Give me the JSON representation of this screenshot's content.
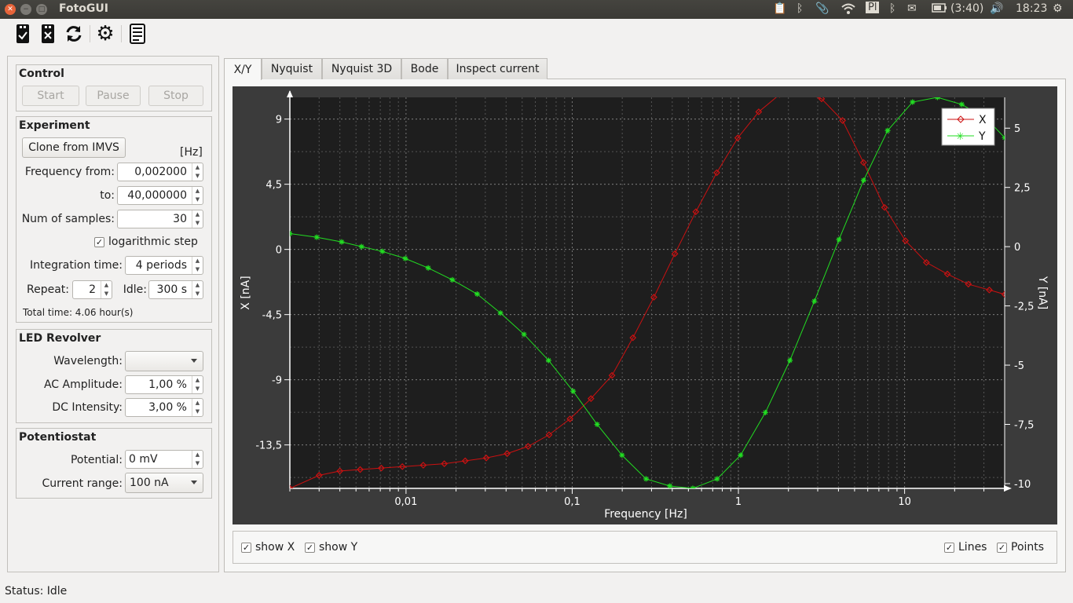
{
  "window": {
    "title": "FotoGUI"
  },
  "tray": {
    "battery": "(3:40)",
    "clock": "18:23",
    "keyboard": "Pl"
  },
  "control": {
    "title": "Control",
    "start": "Start",
    "pause": "Pause",
    "stop": "Stop"
  },
  "experiment": {
    "title": "Experiment",
    "clone_button": "Clone from IMVS",
    "unit": "[Hz]",
    "freq_from_label": "Frequency from:",
    "freq_from": "0,002000",
    "freq_to_label": "to:",
    "freq_to": "40,000000",
    "samples_label": "Num of samples:",
    "samples": "30",
    "log_label": "logarithmic step",
    "integration_label": "Integration time:",
    "integration": "4 periods",
    "repeat_label": "Repeat:",
    "repeat": "2",
    "idle_label": "Idle:",
    "idle": "300 s",
    "total_time": "Total time: 4.06 hour(s)"
  },
  "led": {
    "title": "LED Revolver",
    "wavelength_label": "Wavelength:",
    "wavelength": "",
    "ac_label": "AC Amplitude:",
    "ac": "1,00 %",
    "dc_label": "DC Intensity:",
    "dc": "3,00 %"
  },
  "potentiostat": {
    "title": "Potentiostat",
    "potential_label": "Potential:",
    "potential": "0 mV",
    "range_label": "Current range:",
    "range": "100 nA"
  },
  "tabs": [
    "X/Y",
    "Nyquist",
    "Nyquist 3D",
    "Bode",
    "Inspect current"
  ],
  "options": {
    "show_x": "show X",
    "show_y": "show Y",
    "lines": "Lines",
    "points": "Points"
  },
  "status": "Status: Idle",
  "colors": {
    "x_series": "#cc1111",
    "y_series": "#22dd22",
    "plot_bg": "#1e1e1e"
  },
  "chart_data": {
    "type": "line",
    "xlabel": "Frequency [Hz]",
    "ylabel": "X [nA]",
    "y2label": "Y [nA]",
    "xscale": "log",
    "xlim": [
      0.002,
      40
    ],
    "ylim": [
      -16.5,
      10.5
    ],
    "y2lim": [
      -10.2,
      6.3
    ],
    "x_ticks": [
      0.01,
      0.1,
      1,
      10
    ],
    "x_tick_labels": [
      "0,01",
      "0,1",
      "1",
      "10"
    ],
    "y_ticks": [
      9,
      4.5,
      0,
      -4.5,
      -9,
      -13.5
    ],
    "y_tick_labels": [
      "9",
      "4,5",
      "0",
      "-4,5",
      "-9",
      "-13,5"
    ],
    "y2_ticks": [
      5,
      2.5,
      0,
      -2.5,
      -5,
      -7.5,
      -10
    ],
    "y2_tick_labels": [
      "5",
      "2,5",
      "0",
      "-2,5",
      "-5",
      "-7,5",
      "-10"
    ],
    "grid": true,
    "legend": "top-right",
    "series": [
      {
        "name": "X",
        "axis": "left",
        "color": "#cc1111",
        "marker": "diamond",
        "x": [
          0.002,
          0.003,
          0.004,
          0.0053,
          0.0071,
          0.0095,
          0.0127,
          0.017,
          0.0227,
          0.0304,
          0.0406,
          0.0543,
          0.0726,
          0.097,
          0.1297,
          0.1735,
          0.2319,
          0.3101,
          0.4146,
          0.5543,
          0.7411,
          0.991,
          1.325,
          1.771,
          2.368,
          3.167,
          4.234,
          5.66,
          7.57,
          10.12,
          13.53,
          18.09,
          24.19,
          32.34,
          40
        ],
        "y": [
          -16.5,
          -15.6,
          -15.3,
          -15.2,
          -15.1,
          -15.0,
          -14.9,
          -14.8,
          -14.6,
          -14.4,
          -14.1,
          -13.6,
          -12.8,
          -11.7,
          -10.3,
          -8.7,
          -6.1,
          -3.3,
          -0.3,
          2.6,
          5.3,
          7.7,
          9.5,
          10.7,
          10.9,
          10.4,
          8.9,
          6.0,
          2.9,
          0.6,
          -0.9,
          -1.7,
          -2.4,
          -2.8,
          -3.1
        ]
      },
      {
        "name": "Y",
        "axis": "right",
        "color": "#22dd22",
        "marker": "star",
        "x": [
          0.002,
          0.0029,
          0.0041,
          0.0054,
          0.0072,
          0.0099,
          0.0136,
          0.019,
          0.0268,
          0.037,
          0.0513,
          0.0721,
          0.1013,
          0.1412,
          0.1993,
          0.2781,
          0.387,
          0.5315,
          0.7451,
          1.031,
          1.453,
          2.042,
          2.866,
          4.029,
          5.667,
          7.908,
          11.16,
          15.76,
          22.09,
          31.14,
          40
        ],
        "y": [
          0.55,
          0.4,
          0.2,
          0.0,
          -0.2,
          -0.5,
          -0.9,
          -1.4,
          -2.0,
          -2.8,
          -3.7,
          -4.8,
          -6.1,
          -7.5,
          -8.8,
          -9.8,
          -10.1,
          -10.2,
          -9.8,
          -8.8,
          -7.0,
          -4.8,
          -2.3,
          0.3,
          2.8,
          4.9,
          6.1,
          6.3,
          6.0,
          5.4,
          4.6
        ]
      }
    ]
  }
}
